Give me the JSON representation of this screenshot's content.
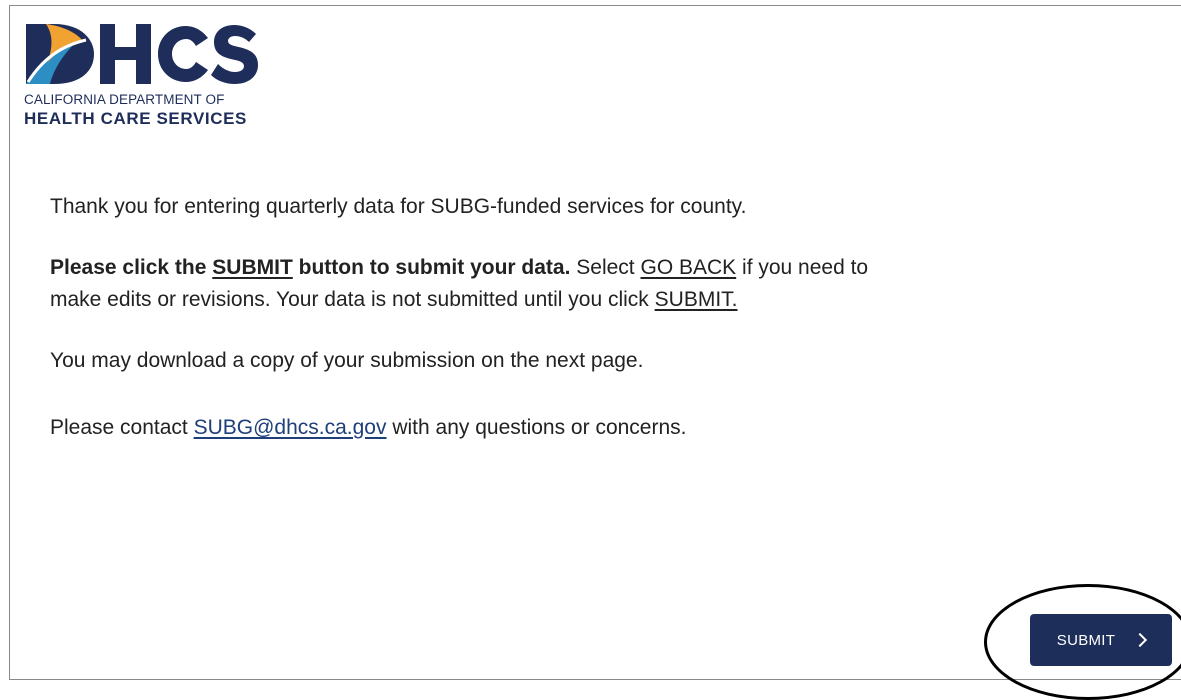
{
  "logo": {
    "wordmark": "DHCS",
    "line1": "CALIFORNIA DEPARTMENT OF",
    "line2": "HEALTH CARE SERVICES",
    "colors": {
      "navy": "#1f2d5a",
      "orange": "#f2a230",
      "blue": "#2d8ec4"
    }
  },
  "message": {
    "thank_you": "Thank you for entering quarterly data for SUBG-funded services for county.",
    "instruction_bold_prefix": "Please click the ",
    "instruction_bold_link": "SUBMIT",
    "instruction_bold_suffix": " button to submit your data.",
    "instruction_select": " Select ",
    "go_back_link": "GO BACK",
    "instruction_rest": " if you need to make edits or revisions. Your data is not submitted until you click ",
    "submit_link": "SUBMIT. ",
    "download_note": "You may download a copy of your submission on the next page.",
    "contact_prefix": "Please contact ",
    "contact_email": "SUBG@dhcs.ca.gov",
    "contact_suffix": " with any questions or concerns."
  },
  "submit_button": {
    "label": "SUBMIT",
    "icon": "chevron-right-icon",
    "color": "#1d2e5b"
  }
}
